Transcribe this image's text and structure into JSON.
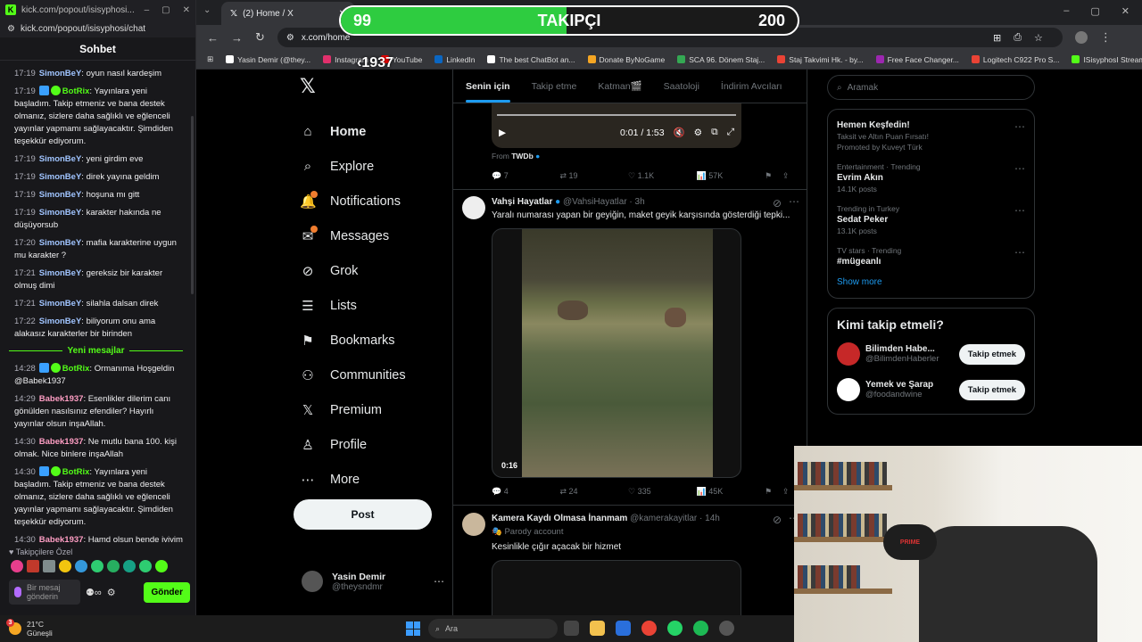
{
  "kick": {
    "tab_title": "kick.com/popout/isisyphosi...",
    "url": "kick.com/popout/isisyphosi/chat",
    "chat_title": "Sohbet",
    "messages_before": [
      {
        "time": "17:19",
        "user": "SimonBeY",
        "color": "#a0c4ff",
        "text": "oyun nasıl kardeşim"
      },
      {
        "time": "17:19",
        "user": "BotRix",
        "color": "#53fc18",
        "bot": true,
        "text": "Yayınlara yeni başladım. Takip etmeniz ve bana destek olmanız, sizlere daha sağlıklı ve eğlenceli yayınlar yapmamı sağlayacaktır. Şimdiden teşekkür ediyorum."
      },
      {
        "time": "17:19",
        "user": "SimonBeY",
        "color": "#a0c4ff",
        "text": "yeni girdim eve"
      },
      {
        "time": "17:19",
        "user": "SimonBeY",
        "color": "#a0c4ff",
        "text": "direk yayına geldim"
      },
      {
        "time": "17:19",
        "user": "SimonBeY",
        "color": "#a0c4ff",
        "text": "hoşuna mı gitt"
      },
      {
        "time": "17:19",
        "user": "SimonBeY",
        "color": "#a0c4ff",
        "text": "karakter hakında ne düşüyorsub"
      },
      {
        "time": "17:20",
        "user": "SimonBeY",
        "color": "#a0c4ff",
        "text": "mafia karakterine uygun mu karakter ?"
      },
      {
        "time": "17:21",
        "user": "SimonBeY",
        "color": "#a0c4ff",
        "text": "gereksiz bir karakter olmuş dimi"
      },
      {
        "time": "17:21",
        "user": "SimonBeY",
        "color": "#a0c4ff",
        "text": "silahla dalsan direk"
      },
      {
        "time": "17:22",
        "user": "SimonBeY",
        "color": "#a0c4ff",
        "text": "biliyorum onu ama alakasız karakterler bir birinden"
      }
    ],
    "new_messages_label": "Yeni mesajlar",
    "messages_after": [
      {
        "time": "14:28",
        "user": "BotRix",
        "color": "#53fc18",
        "bot": true,
        "text": "Ormanıma Hoşgeldin @Babek1937"
      },
      {
        "time": "14:29",
        "user": "Babek1937",
        "color": "#ff9ec4",
        "text": "Esenlikler dilerim canı gönülden nasılsınız efendiler? Hayırlı yayınlar olsun inşaAllah."
      },
      {
        "time": "14:30",
        "user": "Babek1937",
        "color": "#ff9ec4",
        "text": "Ne mutlu bana 100. kişi olmak. Nice binlere inşaAllah"
      },
      {
        "time": "14:30",
        "user": "BotRix",
        "color": "#53fc18",
        "bot": true,
        "text": "Yayınlara yeni başladım. Takip etmeniz ve bana destek olmanız, sizlere daha sağlıklı ve eğlenceli yayınlar yapmamı sağlayacaktır. Şimdiden teşekkür ediyorum."
      },
      {
        "time": "14:30",
        "user": "Babek1937",
        "color": "#ff9ec4",
        "text": "Hamd olsun bende iyiyim efendim teşekkür ederim sorduğunuz için."
      }
    ],
    "emote_label": "Takipçilere Özel",
    "input_placeholder": "Bir mesaj gönderin",
    "send_label": "Gönder"
  },
  "browser": {
    "tab_title": "(2) Home / X",
    "url": "x.com/home",
    "bookmarks": [
      {
        "label": "Yasin Demir (@they...",
        "color": "#ffffff"
      },
      {
        "label": "Instagram",
        "color": "#e1306c"
      },
      {
        "label": "YouTube",
        "color": "#ff0000"
      },
      {
        "label": "LinkedIn",
        "color": "#0a66c2"
      },
      {
        "label": "The best ChatBot an...",
        "color": "#ffffff"
      },
      {
        "label": "Donate ByNoGame",
        "color": "#f5a623"
      },
      {
        "label": "SCA 96. Dönem Staj...",
        "color": "#34a853"
      },
      {
        "label": "Staj Takvimi Hk. - by...",
        "color": "#ea4335"
      },
      {
        "label": "Free Face Changer...",
        "color": "#9c27b0"
      },
      {
        "label": "Logitech C922 Pro S...",
        "color": "#ea4335"
      },
      {
        "label": "ISisyphosI Stream -...",
        "color": "#53fc18"
      }
    ]
  },
  "overlay": {
    "current": "99",
    "label": "TAKIPÇI",
    "goal": "200",
    "progress": 0.495,
    "tag": "‹1937"
  },
  "x_nav": {
    "items": [
      {
        "label": "Home",
        "icon": "home-icon",
        "glyph": "⌂",
        "active": true
      },
      {
        "label": "Explore",
        "icon": "search-icon",
        "glyph": "⌕"
      },
      {
        "label": "Notifications",
        "icon": "bell-icon",
        "glyph": "🔔",
        "dot": true
      },
      {
        "label": "Messages",
        "icon": "mail-icon",
        "glyph": "✉",
        "dot": true
      },
      {
        "label": "Grok",
        "icon": "grok-icon",
        "glyph": "⊘"
      },
      {
        "label": "Lists",
        "icon": "list-icon",
        "glyph": "☰"
      },
      {
        "label": "Bookmarks",
        "icon": "bookmark-icon",
        "glyph": "⚑"
      },
      {
        "label": "Communities",
        "icon": "communities-icon",
        "glyph": "⚇"
      },
      {
        "label": "Premium",
        "icon": "x-icon",
        "glyph": "𝕏"
      },
      {
        "label": "Profile",
        "icon": "person-icon",
        "glyph": "♙"
      },
      {
        "label": "More",
        "icon": "more-icon",
        "glyph": "⋯"
      }
    ],
    "post_label": "Post",
    "profile_name": "Yasin Demir",
    "profile_handle": "@theysndmr"
  },
  "feed": {
    "tabs": [
      "Senin için",
      "Takip etme",
      "Katman🎬",
      "Saatoloji",
      "İndirim Avcıları"
    ],
    "video1": {
      "time": "0:01 / 1:53",
      "from_label": "From",
      "from_name": "TWDb"
    },
    "actions1": {
      "replies": "7",
      "reposts": "19",
      "likes": "1.1K",
      "views": "57K"
    },
    "tweet2": {
      "name": "Vahşi Hayatlar",
      "handle": "@VahsiHayatlar · 3h",
      "text": "Yaralı numarası yapan bir geyiğin, maket geyik karşısında gösterdiği tepki...",
      "video_time": "0:16",
      "replies": "4",
      "reposts": "24",
      "likes": "335",
      "views": "45K"
    },
    "tweet3": {
      "name": "Kamera Kaydı Olmasa İnanmam",
      "handle": "@kamerakayitlar · 14h",
      "parody": "Parody account",
      "text": "Kesinlikle çığır açacak bir hizmet"
    }
  },
  "right": {
    "search_placeholder": "Aramak",
    "trends": [
      {
        "cat": "",
        "title": "Hemen Keşfedin!",
        "posts": "Taksit ve Altın Puan Fırsatı!",
        "promo": "Promoted by Kuveyt Türk"
      },
      {
        "cat": "Entertainment · Trending",
        "title": "Evrim Akın",
        "posts": "14.1K posts"
      },
      {
        "cat": "Trending in Turkey",
        "title": "Sedat Peker",
        "posts": "13.1K posts"
      },
      {
        "cat": "TV stars · Trending",
        "title": "#mügeanlı",
        "posts": ""
      }
    ],
    "show_more": "Show more",
    "who_title": "Kimi takip etmeli?",
    "who": [
      {
        "name": "Bilimden Habe...",
        "handle": "@BilimdenHaberler",
        "button": "Takip etmek",
        "color": "#c62828"
      },
      {
        "name": "Yemek ve Şarap",
        "handle": "@foodandwine",
        "button": "Takip etmek",
        "color": "#ffffff"
      }
    ]
  },
  "webcam": {
    "chair_brand": "PRIME"
  },
  "taskbar": {
    "temp": "21°C",
    "weather": "Güneşli",
    "notif": "3",
    "search": "Ara"
  }
}
